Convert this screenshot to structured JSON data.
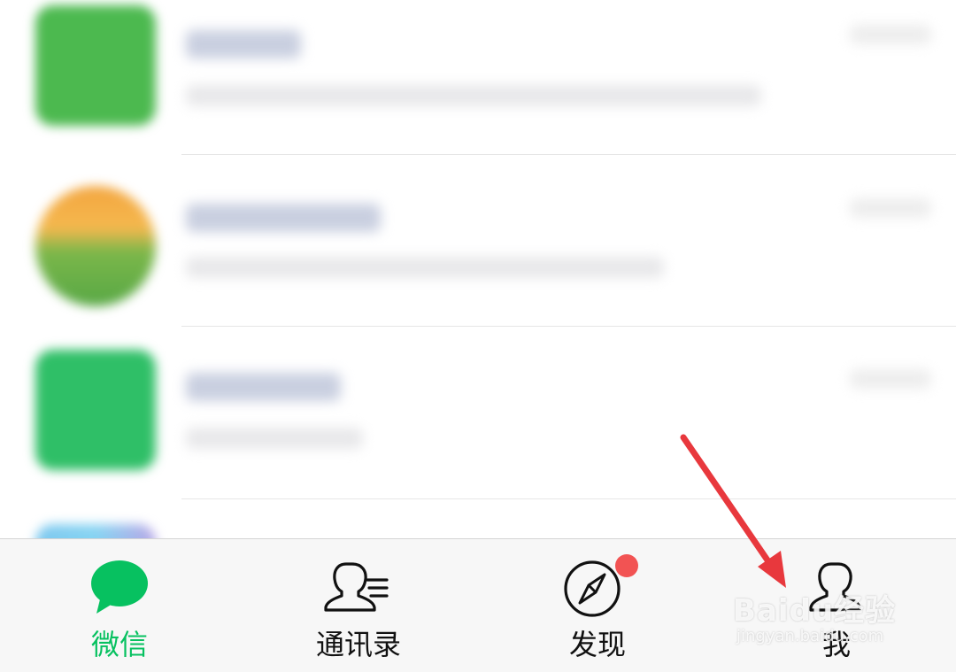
{
  "tabs": [
    {
      "label": "微信",
      "icon": "chat-bubble-icon",
      "active": true
    },
    {
      "label": "通讯录",
      "icon": "contacts-icon",
      "active": false
    },
    {
      "label": "发现",
      "icon": "compass-icon",
      "active": false,
      "badge": true
    },
    {
      "label": "我",
      "icon": "person-icon",
      "active": false
    }
  ],
  "watermark": {
    "main": "Baidu经验",
    "sub": "jingyan.baidu.com"
  },
  "colors": {
    "accent": "#07c160",
    "badge": "#f25353",
    "arrow": "#e8383d"
  }
}
